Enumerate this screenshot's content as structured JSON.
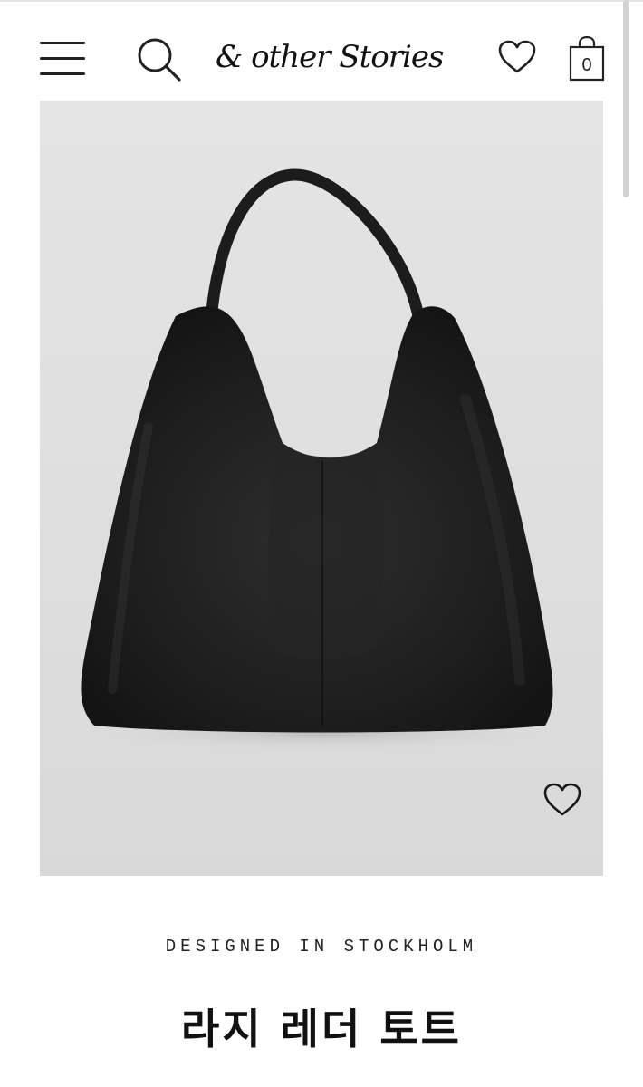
{
  "header": {
    "brand": "& other Stories",
    "bag_count": "0",
    "icons": [
      "menu-icon",
      "search-icon",
      "heart-icon",
      "shopping-bag-icon"
    ]
  },
  "product": {
    "image_icon": "black-leather-hobo-bag",
    "favorite_icon": "heart-icon",
    "tagline": "DESIGNED IN STOCKHOLM",
    "title": "라지 레더 토트"
  },
  "colors": {
    "background": "#ffffff",
    "image_background": "#e0e0e0",
    "bag_leather": "#1e1e1e",
    "text": "#111111"
  }
}
